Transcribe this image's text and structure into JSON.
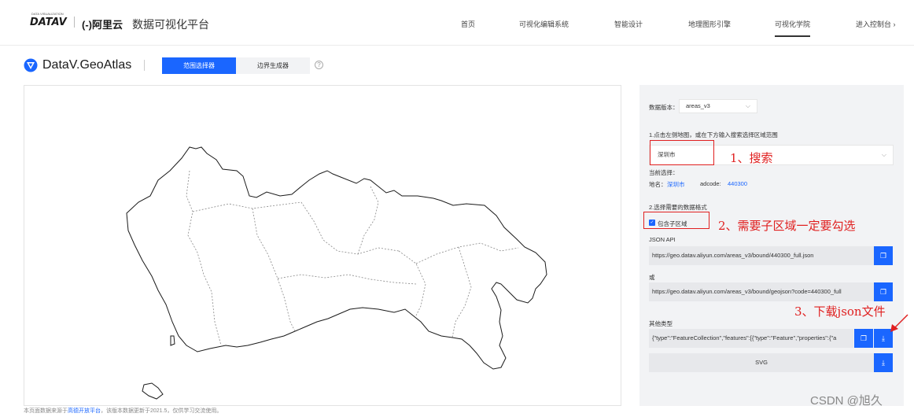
{
  "topnav": {
    "logo_datav": "DATAV",
    "logo_sub": "DATA VISUALIZATION",
    "logo_aliyun": "(-)阿里云",
    "site_title": "数据可视化平台",
    "items": [
      {
        "label": "首页"
      },
      {
        "label": "可视化编辑系统"
      },
      {
        "label": "智能设计"
      },
      {
        "label": "地理图形引擎"
      },
      {
        "label": "可视化学院"
      },
      {
        "label": "进入控制台 ›"
      }
    ]
  },
  "subheader": {
    "brand": "DataV.GeoAtlas",
    "tabs": [
      {
        "label": "范围选择器"
      },
      {
        "label": "边界生成器"
      }
    ],
    "help": "?"
  },
  "footnote": {
    "prefix": "本页面数据来源于",
    "link": "高德开放平台",
    "suffix": "，该版本数据更新于2021.5，仅供学习交流使用。"
  },
  "panel": {
    "data_version_label": "数据版本：",
    "data_version_value": "areas_v3",
    "step1_label": "1.点击左侧地图，或在下方输入搜索选择区域范围",
    "search_value": "深圳市",
    "current_label": "当前选择：",
    "name_label": "地名：",
    "name_value": "深圳市",
    "adcode_label": "adcode:",
    "adcode_value": "440300",
    "step2_label": "2.选择需要的数据格式",
    "checkbox_label": "包含子区域",
    "json_api_label": "JSON API",
    "json_api_url": "https://geo.datav.aliyun.com/areas_v3/bound/440300_full.json",
    "or_label": "或",
    "geojson_url": "https://geo.datav.aliyun.com/areas_v3/bound/geojson?code=440300_full",
    "other_label": "其他类型",
    "other_value": "{\"type\":\"FeatureCollection\",\"features\":[{\"type\":\"Feature\",\"properties\":{\"a",
    "svg_label": "SVG"
  },
  "annotations": {
    "search": "1、搜索",
    "subregion": "2、需要子区域一定要勾选",
    "download": "3、下载json文件"
  },
  "watermark": "CSDN @旭久",
  "colors": {
    "accent": "#1a66ff",
    "annotation": "#e02020",
    "panel_bg": "#f2f3f5"
  }
}
